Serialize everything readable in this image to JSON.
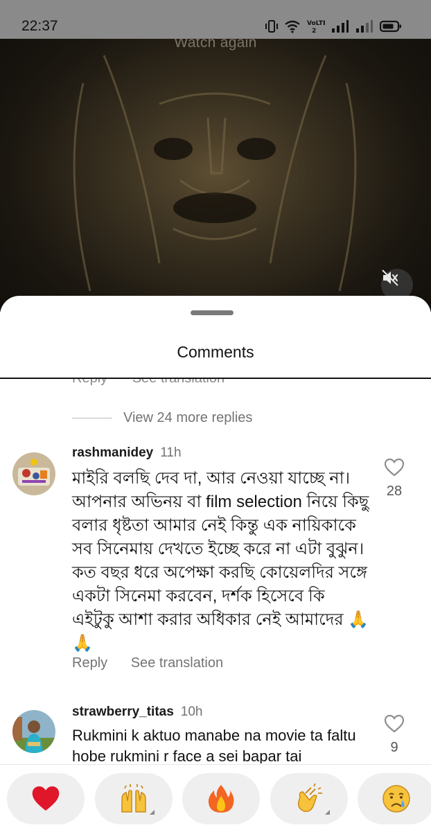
{
  "status_bar": {
    "time": "22:37",
    "network_label": "VoLTE2"
  },
  "video": {
    "overlay_text": "Watch again"
  },
  "sheet": {
    "title": "Comments"
  },
  "clipped_actions": {
    "reply": "Reply",
    "translate": "See translation"
  },
  "thread": {
    "more_replies": "View 24 more replies"
  },
  "comments": [
    {
      "username": "rashmanidey",
      "time": "11h",
      "text": "মাইরি বলছি দেব দা, আর নেওয়া যাচ্ছে না। আপনার অভিনয় বা film selection নিয়ে কিছু বলার ধৃষ্টতা আমার নেই কিন্তু এক নায়িকাকে সব সিনেমায় দেখতে ইচ্ছে করে না এটা বুঝুন। কত বছর ধরে অপেক্ষা করছি কোয়েলদির সঙ্গে একটা সিনেমা করবেন, দর্শক হিসেবে কি এইটুকু আশা করার অধিকার নেই আমাদের 🙏🙏",
      "likes": "28",
      "reply": "Reply",
      "translate": "See translation"
    },
    {
      "username": "strawberry_titas",
      "time": "10h",
      "text": "Rukmini k aktuo manabe na movie ta faltu hobe rukmini r face a sei bapar tai",
      "likes": "9"
    }
  ],
  "reactions": [
    "❤️",
    "🙌",
    "🔥",
    "👏",
    "😢"
  ],
  "colors": {
    "status_bar": "#8a8a8a",
    "sheet_bg": "#ffffff",
    "reaction_pill": "#efefef",
    "secondary_text": "#737373"
  },
  "icons": [
    "vibrate-icon",
    "wifi-icon",
    "signal-icon",
    "battery-icon",
    "mute-icon",
    "heart-outline-icon"
  ]
}
